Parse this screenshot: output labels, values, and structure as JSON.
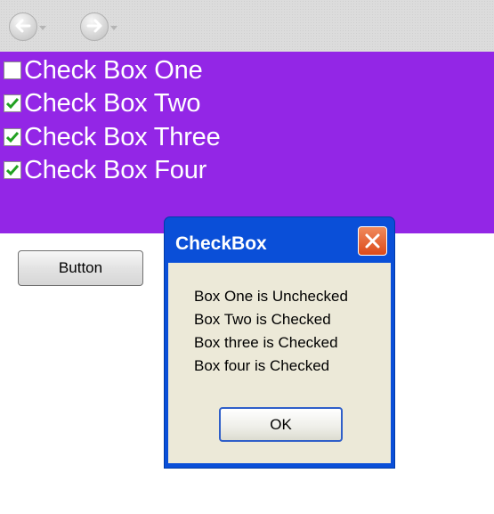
{
  "toolbar": {
    "back_icon": "back-arrow-icon",
    "forward_icon": "forward-arrow-icon"
  },
  "checkboxes": [
    {
      "label": "Check Box One",
      "checked": false
    },
    {
      "label": "Check Box Two",
      "checked": true
    },
    {
      "label": "Check Box Three",
      "checked": true
    },
    {
      "label": "Check Box Four",
      "checked": true
    }
  ],
  "colors": {
    "panel": "#9326e6",
    "dialog_title_bar": "#0a4fd8",
    "close_button": "#dc4a1a",
    "check_mark": "#21a121"
  },
  "main_button": {
    "label": "Button"
  },
  "dialog": {
    "title": "CheckBox",
    "lines": [
      "Box One is Unchecked",
      "Box Two is Checked",
      "Box three is Checked",
      "Box four is Checked"
    ],
    "ok_label": "OK",
    "close_icon": "close-icon"
  }
}
